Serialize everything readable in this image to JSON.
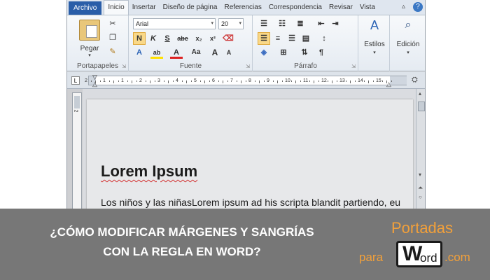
{
  "tabs": [
    "Archivo",
    "Inicio",
    "Insertar",
    "Diseño de página",
    "Referencias",
    "Correspondencia",
    "Revisar",
    "Vista"
  ],
  "ribbon": {
    "paste_label": "Pegar",
    "clipboard_label": "Portapapeles",
    "font_name": "Arial",
    "font_size": "20",
    "font_label": "Fuente",
    "paragraph_label": "Párrafo",
    "styles_label": "Estilos",
    "edit_label": "Edición",
    "bold": "N",
    "italic": "K",
    "underline": "S",
    "strike": "abe",
    "subscript": "x₂",
    "superscript": "x²",
    "grow": "A",
    "shrink": "A",
    "case": "Aa"
  },
  "ruler_numbers": [
    "2",
    "1",
    "1",
    "2",
    "3",
    "4",
    "5",
    "6",
    "7",
    "8",
    "9",
    "10",
    "11",
    "12",
    "13",
    "14",
    "15"
  ],
  "document": {
    "heading": "Lorem Ipsum",
    "body": "Los niños y las niñasLorem ipsum ad his scripta blandit partiendo, eu"
  },
  "banner": {
    "line1": "¿CÓMO MODIFICAR MÁRGENES Y SANGRÍAS",
    "line2": "CON LA REGLA EN WORD?",
    "logo_top": "Portadas",
    "logo_para": "para",
    "logo_w": "W",
    "logo_ord": "ord",
    "logo_com": ".com"
  },
  "colors": {
    "banner_bg": "#777777",
    "logo_orange": "#f2a03a",
    "file_tab": "#2a5ea8"
  }
}
